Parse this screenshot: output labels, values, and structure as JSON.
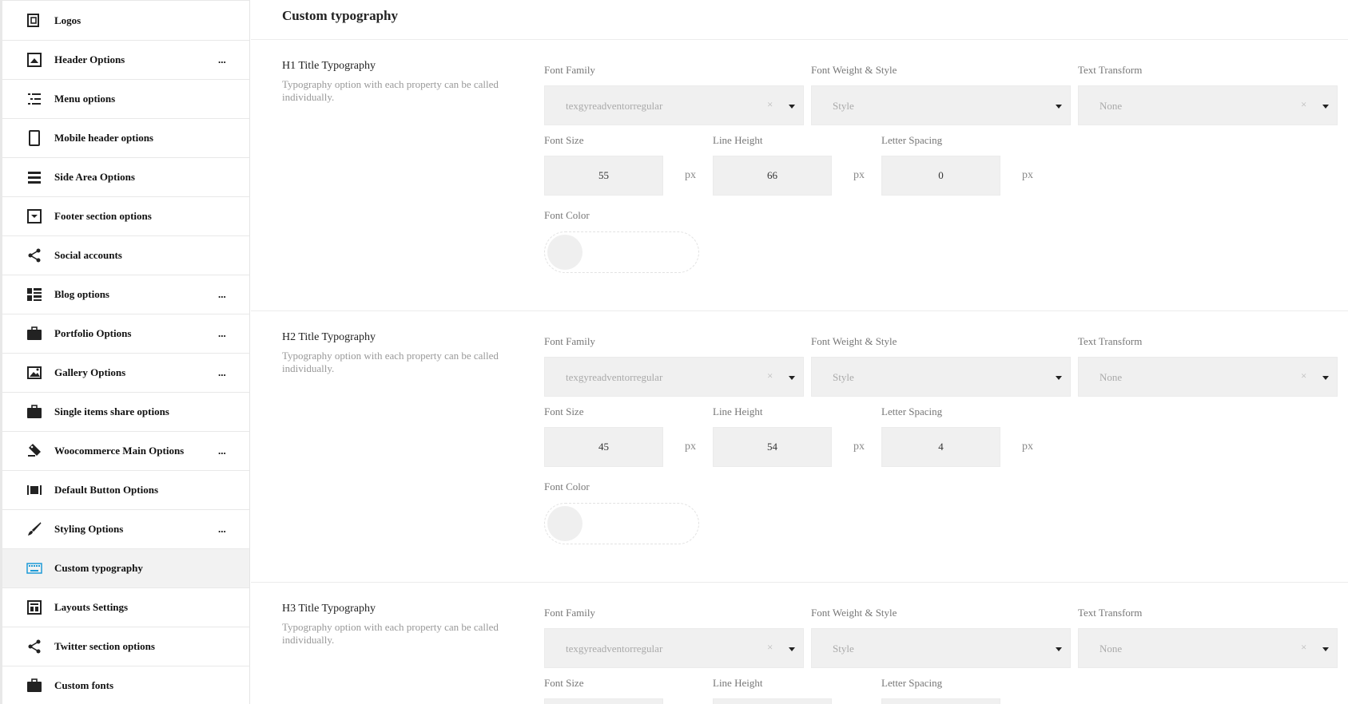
{
  "sidebar": {
    "items": [
      {
        "label": "Logos",
        "icon": "logos-icon",
        "dots": ""
      },
      {
        "label": "Header Options",
        "icon": "header-icon",
        "dots": "..."
      },
      {
        "label": "Menu options",
        "icon": "menu-icon",
        "dots": ""
      },
      {
        "label": "Mobile header options",
        "icon": "mobile-icon",
        "dots": ""
      },
      {
        "label": "Side Area Options",
        "icon": "side-area-icon",
        "dots": ""
      },
      {
        "label": "Footer section options",
        "icon": "footer-icon",
        "dots": ""
      },
      {
        "label": "Social accounts",
        "icon": "share-icon",
        "dots": ""
      },
      {
        "label": "Blog options",
        "icon": "blog-icon",
        "dots": "..."
      },
      {
        "label": "Portfolio Options",
        "icon": "briefcase-icon",
        "dots": "..."
      },
      {
        "label": "Gallery Options",
        "icon": "gallery-icon",
        "dots": "..."
      },
      {
        "label": "Single items share options",
        "icon": "briefcase-icon",
        "dots": ""
      },
      {
        "label": "Woocommerce Main Options",
        "icon": "tag-icon",
        "dots": "..."
      },
      {
        "label": "Default Button Options",
        "icon": "button-icon",
        "dots": ""
      },
      {
        "label": "Styling Options",
        "icon": "brush-icon",
        "dots": "..."
      },
      {
        "label": "Custom typography",
        "icon": "keyboard-icon",
        "dots": "",
        "active": true
      },
      {
        "label": "Layouts Settings",
        "icon": "layout-icon",
        "dots": ""
      },
      {
        "label": "Twitter section options",
        "icon": "share-icon",
        "dots": ""
      },
      {
        "label": "Custom fonts",
        "icon": "briefcase-icon",
        "dots": ""
      }
    ]
  },
  "main": {
    "title": "Custom typography",
    "labels": {
      "font_family": "Font Family",
      "font_weight": "Font Weight & Style",
      "text_transform": "Text Transform",
      "font_size": "Font Size",
      "line_height": "Line Height",
      "letter_spacing": "Letter Spacing",
      "font_color": "Font Color",
      "unit": "px",
      "clear": "×"
    },
    "sections": [
      {
        "title": "H1 Title Typography",
        "desc": "Typography option with each property can be called individually.",
        "font_family": "texgyreadventorregular",
        "weight": "Style",
        "transform": "None",
        "font_size": "55",
        "line_height": "66",
        "letter_spacing": "0"
      },
      {
        "title": "H2 Title Typography",
        "desc": "Typography option with each property can be called individually.",
        "font_family": "texgyreadventorregular",
        "weight": "Style",
        "transform": "None",
        "font_size": "45",
        "line_height": "54",
        "letter_spacing": "4"
      },
      {
        "title": "H3 Title Typography",
        "desc": "Typography option with each property can be called individually.",
        "font_family": "texgyreadventorregular",
        "weight": "Style",
        "transform": "None"
      }
    ]
  },
  "colors": {
    "active_icon": "#1e9bd7",
    "swatch": "#efefef"
  }
}
